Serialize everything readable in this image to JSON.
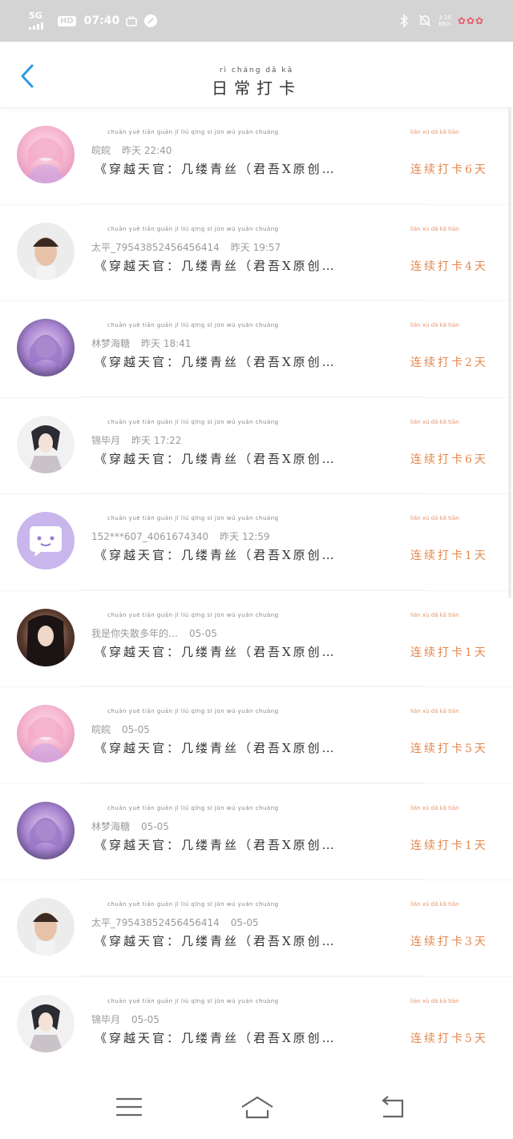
{
  "status_bar": {
    "network": "5G",
    "hd": "HD",
    "time": "07:40",
    "speed_top": "3.10",
    "speed_bottom": "KB/s"
  },
  "header": {
    "title": "日常打卡",
    "title_pinyin": "rì cháng dǎ kǎ"
  },
  "course_pinyin": "chuān yuè tiān guān   jī liú qīng sī   jūn wú yuán chuàng",
  "streak_pinyin": "lián xù dǎ kǎ tiān",
  "items": [
    {
      "name": "皖皖",
      "time": "昨天 22:40",
      "course": "《穿越天官：几缕青丝（君吾X原创…",
      "streak": "连续打卡6天"
    },
    {
      "name": "太平_79543852456456414",
      "time": "昨天 19:57",
      "course": "《穿越天官：几缕青丝（君吾X原创…",
      "streak": "连续打卡4天"
    },
    {
      "name": "林梦海糖",
      "time": "昨天 18:41",
      "course": "《穿越天官：几缕青丝（君吾X原创…",
      "streak": "连续打卡2天"
    },
    {
      "name": "锦毕月",
      "time": "昨天 17:22",
      "course": "《穿越天官：几缕青丝（君吾X原创…",
      "streak": "连续打卡6天"
    },
    {
      "name": "152***607_4061674340",
      "time": "昨天 12:59",
      "course": "《穿越天官：几缕青丝（君吾X原创…",
      "streak": "连续打卡1天"
    },
    {
      "name": "我是你失散多年的…",
      "time": "05-05",
      "course": "《穿越天官：几缕青丝（君吾X原创…",
      "streak": "连续打卡1天"
    },
    {
      "name": "皖皖",
      "time": "05-05",
      "course": "《穿越天官：几缕青丝（君吾X原创…",
      "streak": "连续打卡5天"
    },
    {
      "name": "林梦海糖",
      "time": "05-05",
      "course": "《穿越天官：几缕青丝（君吾X原创…",
      "streak": "连续打卡1天"
    },
    {
      "name": "太平_79543852456456414",
      "time": "05-05",
      "course": "《穿越天官：几缕青丝（君吾X原创…",
      "streak": "连续打卡3天"
    },
    {
      "name": "锦毕月",
      "time": "05-05",
      "course": "《穿越天官：几缕青丝（君吾X原创…",
      "streak": "连续打卡5天"
    }
  ],
  "colors": {
    "accent": "#2f9ae0",
    "streak": "#e5884f",
    "status_bar": "#d4d4d4"
  }
}
